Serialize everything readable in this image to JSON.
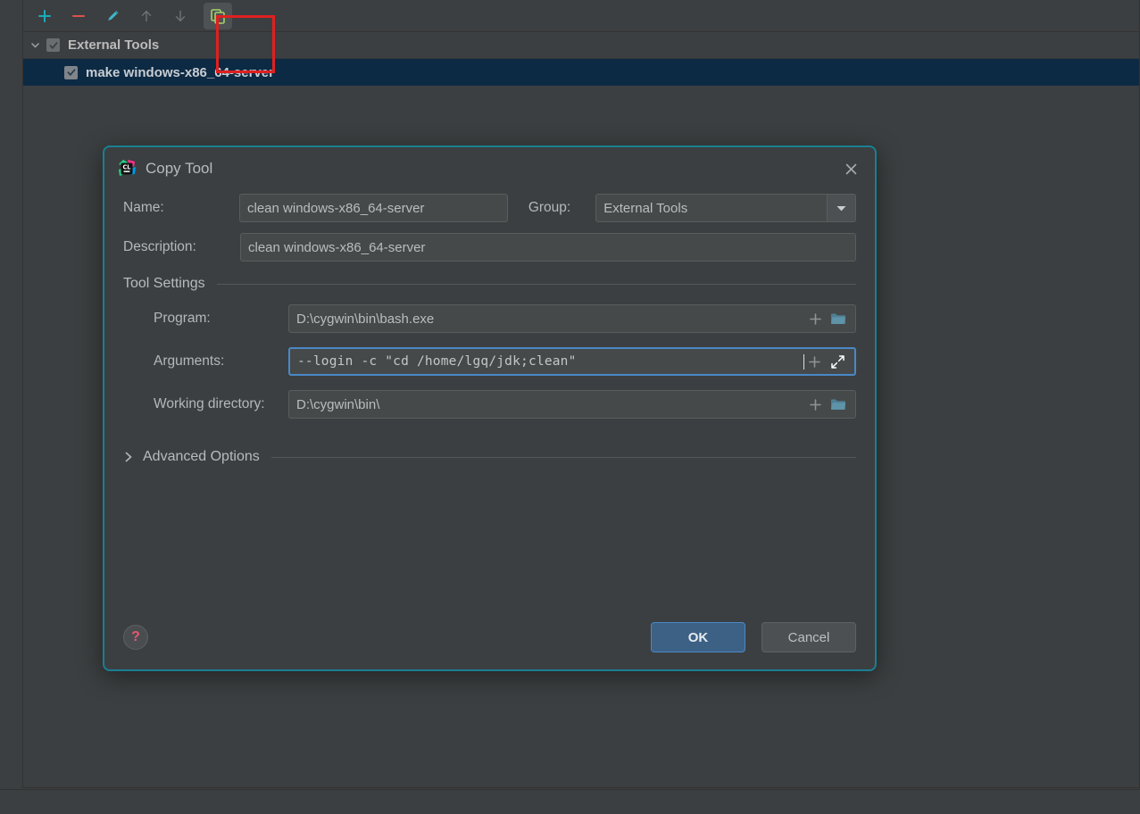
{
  "toolbar": {
    "buttons": [
      {
        "name": "add-button",
        "icon": "plus-icon",
        "color": "#1aabb8",
        "enabled": true
      },
      {
        "name": "remove-button",
        "icon": "minus-icon",
        "color": "#d9534f",
        "enabled": true
      },
      {
        "name": "edit-button",
        "icon": "pencil-icon",
        "color": "#3fb6c8",
        "enabled": true
      },
      {
        "name": "move-up-button",
        "icon": "arrow-up-icon",
        "color": "#6e7376",
        "enabled": false
      },
      {
        "name": "move-down-button",
        "icon": "arrow-down-icon",
        "color": "#6e7376",
        "enabled": false
      },
      {
        "name": "copy-button",
        "icon": "copy-icon",
        "color": "#a5d16a",
        "enabled": true
      }
    ],
    "annotation_color": "#e02020"
  },
  "tree": {
    "group": {
      "label": "External Tools",
      "checked": true,
      "expanded": true
    },
    "item": {
      "label": "make windows-x86_64-server",
      "checked": true,
      "selected": true,
      "selection_color": "#0d2a44"
    }
  },
  "dialog": {
    "title": "Copy Tool",
    "app_icon": "clion-icon",
    "close_icon": "close-icon",
    "border_color": "#1a7f92",
    "name": {
      "label": "Name:",
      "value": "clean windows-x86_64-server"
    },
    "group": {
      "label": "Group:",
      "value": "External Tools",
      "dropdown_icon": "chevron-down-icon"
    },
    "description": {
      "label": "Description:",
      "value": "clean windows-x86_64-server"
    },
    "tool_settings": {
      "section_label": "Tool Settings",
      "program": {
        "label": "Program:",
        "value": "D:\\cygwin\\bin\\bash.exe",
        "insert_icon": "plus-icon",
        "browse_icon": "folder-icon"
      },
      "arguments": {
        "label": "Arguments:",
        "value": "--login -c \"cd /home/lgq/jdk;clean\"",
        "focused": true,
        "insert_icon": "plus-icon",
        "expand_icon": "expand-icon"
      },
      "working_directory": {
        "label": "Working directory:",
        "value": "D:\\cygwin\\bin\\",
        "insert_icon": "plus-icon",
        "browse_icon": "folder-icon"
      }
    },
    "advanced_options": {
      "label": "Advanced Options",
      "expanded": false,
      "chevron_icon": "chevron-right-icon"
    },
    "footer": {
      "help_label": "?",
      "help_icon": "help-icon",
      "ok_label": "OK",
      "cancel_label": "Cancel",
      "ok_color": "#3d6185"
    }
  }
}
